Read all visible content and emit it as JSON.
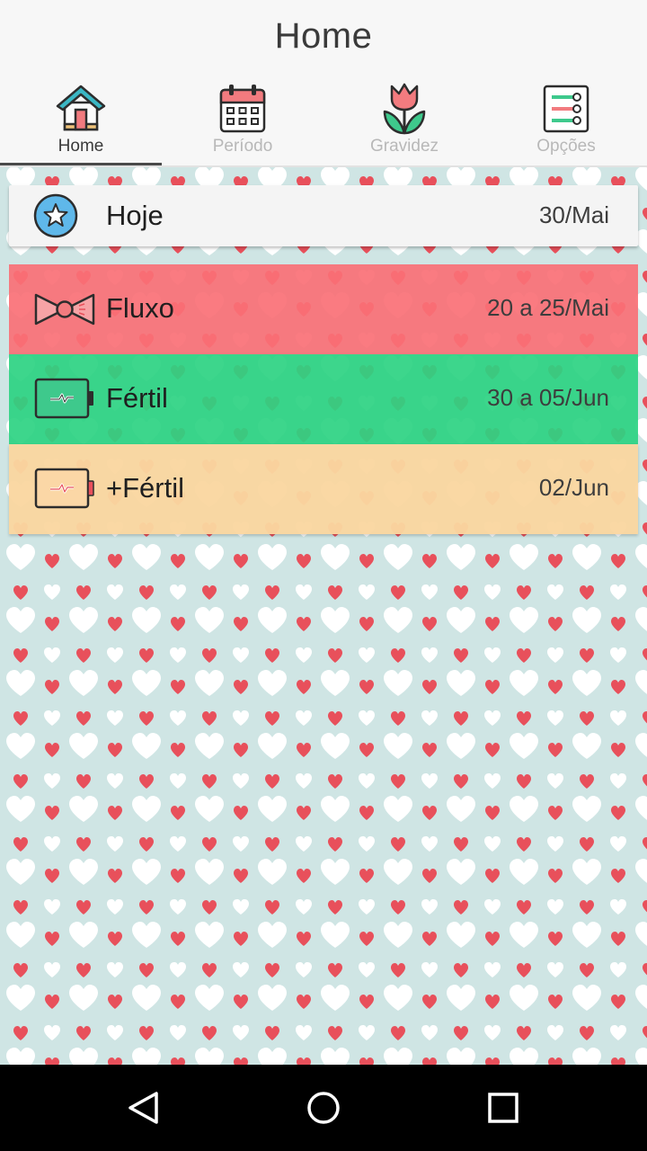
{
  "header": {
    "title": "Home"
  },
  "tabs": [
    {
      "id": "home",
      "label": "Home",
      "icon": "house-icon",
      "active": true
    },
    {
      "id": "periodo",
      "label": "Período",
      "icon": "calendar-icon",
      "active": false
    },
    {
      "id": "gravidez",
      "label": "Gravidez",
      "icon": "tulip-icon",
      "active": false
    },
    {
      "id": "opcoes",
      "label": "Opções",
      "icon": "settings-list-icon",
      "active": false
    }
  ],
  "cards": {
    "today": {
      "label": "Hoje",
      "date": "30/Mai",
      "icon": "star-icon"
    },
    "flow": {
      "label": "Fluxo",
      "date": "20 a 25/Mai",
      "icon": "bow-icon"
    },
    "fertile": {
      "label": "Fértil",
      "date": "30 a 05/Jun",
      "icon": "battery-icon"
    },
    "peak": {
      "label": "+Fértil",
      "date": "02/Jun",
      "icon": "battery-charged-icon"
    }
  },
  "colors": {
    "flow": "#fa7076",
    "fertile": "#2dd282",
    "peak": "#fad6a0",
    "background": "#cfe5e4",
    "heart_red": "#e8505b"
  },
  "navbar": {
    "back": "back-triangle-icon",
    "home": "home-circle-icon",
    "recents": "recents-square-icon"
  }
}
